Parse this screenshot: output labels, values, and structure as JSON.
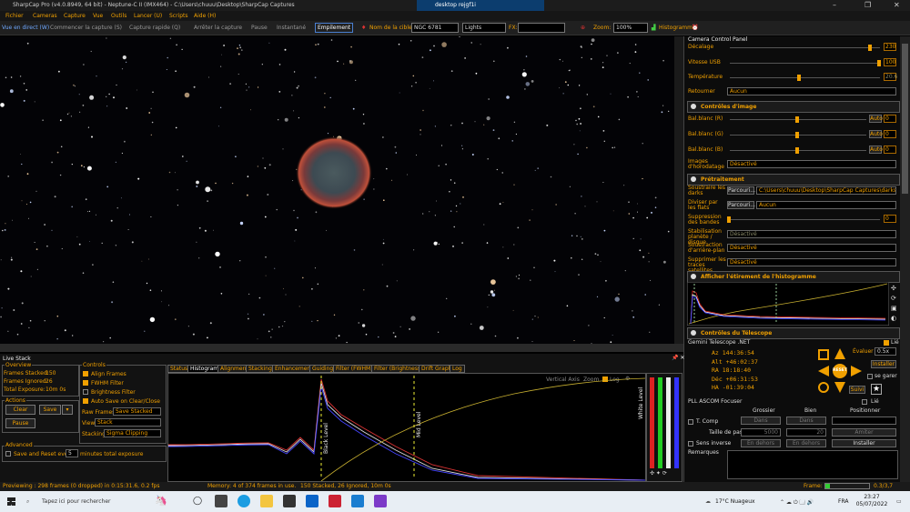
{
  "window": {
    "title": "SharpCap Pro (v4.0.8949, 64 bit) - Neptune-C II (IMX464) - C:\\Users\\chuuu\\Desktop\\SharpCap Captures",
    "remote_label": "desktop rejgf1i"
  },
  "menu": [
    "Fichier",
    "Cameras",
    "Capture",
    "Vue",
    "Outils",
    "Lancer (U)",
    "Scripts",
    "Aide (H)"
  ],
  "toolbar": {
    "live_view": "Vue en direct (W)",
    "start_capture": "Commencer la capture (S)",
    "quick_capture": "Capture rapide (Q)",
    "stop_capture": "Arrêter la capture",
    "pause": "Pause",
    "snapshot": "Instantané",
    "stacking": "Empilement",
    "target_label": "Nom de la cible",
    "target_value": "NGC 6781",
    "lights_value": "Lights",
    "fx_label": "FX:",
    "zoom_label": "Zoom:",
    "zoom_value": "100%",
    "histogram": "Histogramme"
  },
  "camera_control": {
    "title": "Camera Control Panel",
    "rows": [
      {
        "label": "Décalage",
        "value": "230",
        "level": 0.93
      },
      {
        "label": "Vitesse USB",
        "value": "100",
        "level": 1.0
      },
      {
        "label": "Température",
        "value": "20.6",
        "level": 0.55
      }
    ],
    "flip_label": "Retourner",
    "flip_value": "Aucun"
  },
  "image_controls": {
    "title": "Contrôles d'image",
    "rows": [
      {
        "label": "Bal.blanc (R)",
        "auto": "Auto",
        "value": "0",
        "level": 0.45
      },
      {
        "label": "Bal.blanc (G)",
        "auto": "Auto",
        "value": "0",
        "level": 0.45
      },
      {
        "label": "Bal.blanc (B)",
        "auto": "Auto",
        "value": "0",
        "level": 0.45
      }
    ],
    "timestamp_label": "Images d'horodatage",
    "timestamp_value": "Désactivé"
  },
  "preprocessing": {
    "title": "Prétraitement",
    "browse": "Parcouri...",
    "darks_label": "Soustraire les darks",
    "darks_value": "C:\\Users\\chuuu\\Desktop\\SharpCap Captures\\darks\\Ne...",
    "flats_label": "Diviser par les flats",
    "flats_value": "Aucun",
    "banding_label": "Suppression des bandes",
    "banding_value": "0",
    "planet_label": "Stabilisation planète / disque",
    "planet_value": "Désactivé",
    "bg_label": "Soustraction d'arrière-plan",
    "bg_value": "Désactivé",
    "sat_label": "Supprimer les traces satellites",
    "sat_value": "Désactivé"
  },
  "histogram_panel": {
    "title": "Afficher l'étirement de l'histogramme"
  },
  "telescope": {
    "title": "Contrôles du Télescope",
    "driver": "Gemini Telescope .NET",
    "lie_label": "Lié",
    "az": "Az 144:36:54",
    "alt": "Alt +46:02:37",
    "ra": "RA 18:18:40",
    "dec": "Déc +06:31:53",
    "ha": "HA -01:39:04",
    "speed_label": "Évaluer",
    "speed_value": "0.5x",
    "install": "Installer",
    "park_label": "se garer",
    "follow": "Suivi",
    "reset": "RESET"
  },
  "focuser": {
    "title": "PLL ASCOM Focuser",
    "lie_label": "Lié",
    "coarse": "Grossier",
    "fine": "Bien",
    "position": "Positionner",
    "t_comp": "T. Comp",
    "step_label": "Taille de pas",
    "step_coarse": "5000",
    "step_fine": "20",
    "reverse_label": "Sens inverse",
    "in_label": "Dans",
    "out_label": "En dehors",
    "apply": "Amiter",
    "install": "Installer",
    "notes_label": "Remarques"
  },
  "frame_info": {
    "label": "Frame:",
    "value": "0.3/3,7"
  },
  "live_stack": {
    "title": "Live Stack",
    "overview_label": "Overview",
    "frames_stacked_label": "Frames Stacked:",
    "frames_stacked": "150",
    "frames_ignored_label": "Frames Ignored:",
    "frames_ignored": "26",
    "total_exposure_label": "Total Exposure:",
    "total_exposure": "10m 0s",
    "actions_label": "Actions",
    "clear": "Clear",
    "save": "Save",
    "pause": "Pause",
    "controls_label": "Controls",
    "align": "Align Frames",
    "fwhm": "FWHM Filter",
    "brightness": "Brightness Filter",
    "autosave": "Auto Save on Clear/Close",
    "raw_frames_label": "Raw Frames",
    "raw_frames_value": "Save Stacked",
    "view_label": "View",
    "view_value": "Stack",
    "stacking_label": "Stacking",
    "stacking_value": "Sigma Clipping",
    "advanced_label": "Advanced",
    "save_reset": "Save and Reset every",
    "save_reset_value": "5",
    "save_reset_suffix": "minutes total exposure",
    "tabs": [
      "Status",
      "Histogram",
      "Alignment",
      "Stacking",
      "Enhancement",
      "Guiding",
      "Filter (FWHM)",
      "Filter (Brightness)",
      "Drift Graph",
      "Log"
    ],
    "selected_tab": "Histogram",
    "hist_ctrl": "Vertical Axis",
    "zoom_label": "Zoom",
    "log_label": "Log",
    "black_level": "Black Level",
    "mid_level": "Mid Level",
    "white_level": "White Level"
  },
  "statusbar": {
    "preview": "Previewing : 298 frames (0 dropped) in 0:15:31.6, 0.2 fps",
    "memory": "Memory: 4 of 374 frames in use.",
    "stacked": "150 Stacked, 26 Ignored, 10m 0s"
  },
  "taskbar": {
    "search_placeholder": "Tapez ici pour rechercher",
    "weather": "17°C  Nuageux",
    "lang": "FRA",
    "time": "23:27",
    "date": "05/07/2022"
  },
  "colors": {
    "accent": "#f0a000",
    "panel": "#0c0c0c",
    "nebula_ring": "#c0503a"
  }
}
